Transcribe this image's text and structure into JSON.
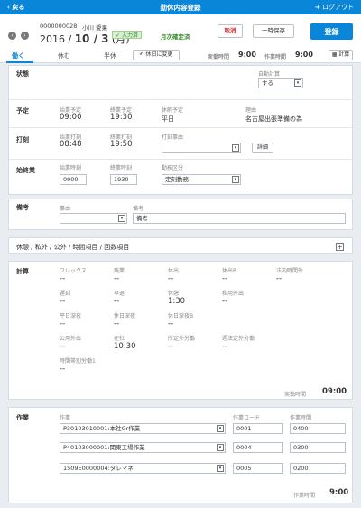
{
  "topbar": {
    "back": "戻る",
    "title": "勤休内容登録",
    "logout": "ログアウト"
  },
  "header": {
    "employee_no": "0000000028",
    "employee_name": "小川 愛果",
    "date_year": "2016 /",
    "date_md": "10 / 3",
    "date_dow": "(月)",
    "badge_input": "入力済",
    "badge_monthly": "月次確定済",
    "cancel": "取消",
    "save_temp": "一時保存",
    "register": "登録",
    "tabs": [
      "働く",
      "休む",
      "半休"
    ],
    "change_holiday": "休日に変更",
    "actual_label": "実働時間",
    "actual_value": "9:00",
    "work_label": "作業時間",
    "work_value": "9:00",
    "calc": "計算"
  },
  "status": {
    "label": "状態",
    "auto_calc_label": "自動計算",
    "auto_calc_value": "する"
  },
  "schedule": {
    "label": "予定",
    "items": [
      {
        "label": "始業予定",
        "value": "09:00"
      },
      {
        "label": "終業予定",
        "value": "19:30"
      },
      {
        "label": "休暇予定",
        "value": "平日"
      },
      {
        "label": "理由",
        "value": "名古屋出張準備の為"
      }
    ]
  },
  "punch": {
    "label": "打刻",
    "start_label": "始業打刻",
    "start_value": "08:48",
    "end_label": "終業打刻",
    "end_value": "19:50",
    "reason_label": "打刻事由",
    "reason_value": "",
    "detail": "詳細"
  },
  "work_time": {
    "label": "始終業",
    "start_label": "始業時刻",
    "start_value": "0900",
    "end_label": "終業時刻",
    "end_value": "1930",
    "type_label": "勤務区分",
    "type_value": "定刻勤務"
  },
  "remarks": {
    "label": "備考",
    "reason_label": "事由",
    "reason_value": "",
    "note_label": "備考",
    "note_value": "備考"
  },
  "breaks": {
    "label": "休憩 / 私外 / 公外 / 時間項目 / 回数項目"
  },
  "calc": {
    "label": "計算",
    "rows": [
      [
        {
          "label": "フレックス",
          "value": "--"
        },
        {
          "label": "残業",
          "value": "--"
        },
        {
          "label": "休出",
          "value": "--"
        },
        {
          "label": "休出B",
          "value": "--"
        },
        {
          "label": "法内時間外",
          "value": "--"
        }
      ],
      [
        {
          "label": "遅刻",
          "value": "--"
        },
        {
          "label": "早退",
          "value": "--"
        },
        {
          "label": "休憩",
          "value": "1:30"
        },
        {
          "label": "私用外出",
          "value": "--"
        }
      ],
      [
        {
          "label": "平日深夜",
          "value": "--"
        },
        {
          "label": "休日深夜",
          "value": "--"
        },
        {
          "label": "休日深夜B",
          "value": "--"
        }
      ],
      [
        {
          "label": "公用外出",
          "value": "--"
        },
        {
          "label": "在社",
          "value": "10:30"
        },
        {
          "label": "所定外労働",
          "value": "--"
        },
        {
          "label": "週法定外労働",
          "value": "--"
        }
      ],
      [
        {
          "label": "時間帯別労働1",
          "value": "--"
        }
      ]
    ],
    "actual_label": "実働時間",
    "actual_value": "09:00"
  },
  "tasks": {
    "label": "作業",
    "col_task": "作業",
    "col_code": "作業コード",
    "col_time": "作業時間",
    "rows": [
      {
        "task": "P30103010001:本社Gr作業",
        "code": "0001",
        "time": "0400"
      },
      {
        "task": "P40103000001:関東工場作業",
        "code": "0004",
        "time": "0300"
      },
      {
        "task": "1509E0000004:タレマネ",
        "code": "0005",
        "time": "0200"
      }
    ],
    "total_label": "作業時間",
    "total_value": "9:00"
  }
}
